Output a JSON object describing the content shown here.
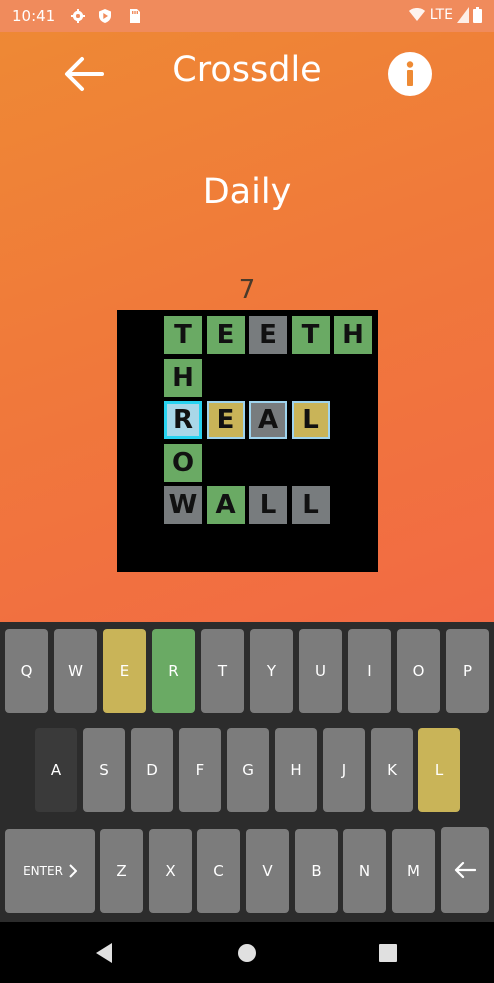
{
  "status": {
    "time": "10:41",
    "network": "LTE"
  },
  "header": {
    "title": "Crossdle"
  },
  "mode": "Daily",
  "puzzle_number": "7",
  "words": [
    "TEETH",
    "THROW",
    "REAL",
    "WALL"
  ],
  "board": [
    {
      "id": "t1",
      "row": 0,
      "col": 1,
      "letter": "T",
      "state": "green"
    },
    {
      "id": "t2",
      "row": 0,
      "col": 2,
      "letter": "E",
      "state": "green"
    },
    {
      "id": "t3",
      "row": 0,
      "col": 3,
      "letter": "E",
      "state": "gray"
    },
    {
      "id": "t4",
      "row": 0,
      "col": 4,
      "letter": "T",
      "state": "green"
    },
    {
      "id": "t5",
      "row": 0,
      "col": 5,
      "letter": "H",
      "state": "green"
    },
    {
      "id": "t6",
      "row": 1,
      "col": 1,
      "letter": "H",
      "state": "green"
    },
    {
      "id": "t7",
      "row": 2,
      "col": 1,
      "letter": "R",
      "state": "active"
    },
    {
      "id": "t8",
      "row": 2,
      "col": 2,
      "letter": "E",
      "state": "yellow-sel"
    },
    {
      "id": "t9",
      "row": 2,
      "col": 3,
      "letter": "A",
      "state": "gray-sel"
    },
    {
      "id": "t10",
      "row": 2,
      "col": 4,
      "letter": "L",
      "state": "yellow-sel"
    },
    {
      "id": "t11",
      "row": 3,
      "col": 1,
      "letter": "O",
      "state": "green"
    },
    {
      "id": "t12",
      "row": 4,
      "col": 1,
      "letter": "W",
      "state": "gray"
    },
    {
      "id": "t13",
      "row": 4,
      "col": 2,
      "letter": "A",
      "state": "green"
    },
    {
      "id": "t14",
      "row": 4,
      "col": 3,
      "letter": "L",
      "state": "gray"
    },
    {
      "id": "t15",
      "row": 4,
      "col": 4,
      "letter": "L",
      "state": "gray"
    }
  ],
  "keyboard": {
    "row1": [
      {
        "k": "Q",
        "s": "gray"
      },
      {
        "k": "W",
        "s": "gray"
      },
      {
        "k": "E",
        "s": "yellow"
      },
      {
        "k": "R",
        "s": "green"
      },
      {
        "k": "T",
        "s": "gray"
      },
      {
        "k": "Y",
        "s": "gray"
      },
      {
        "k": "U",
        "s": "gray"
      },
      {
        "k": "I",
        "s": "gray"
      },
      {
        "k": "O",
        "s": "gray"
      },
      {
        "k": "P",
        "s": "gray"
      }
    ],
    "row2": [
      {
        "k": "A",
        "s": "dark"
      },
      {
        "k": "S",
        "s": "gray"
      },
      {
        "k": "D",
        "s": "gray"
      },
      {
        "k": "F",
        "s": "gray"
      },
      {
        "k": "G",
        "s": "gray"
      },
      {
        "k": "H",
        "s": "gray"
      },
      {
        "k": "J",
        "s": "gray"
      },
      {
        "k": "K",
        "s": "gray"
      },
      {
        "k": "L",
        "s": "yellow"
      }
    ],
    "row3": [
      {
        "k": "Z",
        "s": "gray"
      },
      {
        "k": "X",
        "s": "gray"
      },
      {
        "k": "C",
        "s": "gray"
      },
      {
        "k": "V",
        "s": "gray"
      },
      {
        "k": "B",
        "s": "gray"
      },
      {
        "k": "N",
        "s": "gray"
      },
      {
        "k": "M",
        "s": "gray"
      }
    ],
    "enter_label": "ENTER",
    "enter_icon": "chevron-right-icon",
    "backspace_icon": "backspace-arrow-icon"
  },
  "colors": {
    "green": "#6aaa64",
    "yellow": "#c9b458",
    "gray": "#787c7e",
    "active_border": "#28d3f0"
  }
}
